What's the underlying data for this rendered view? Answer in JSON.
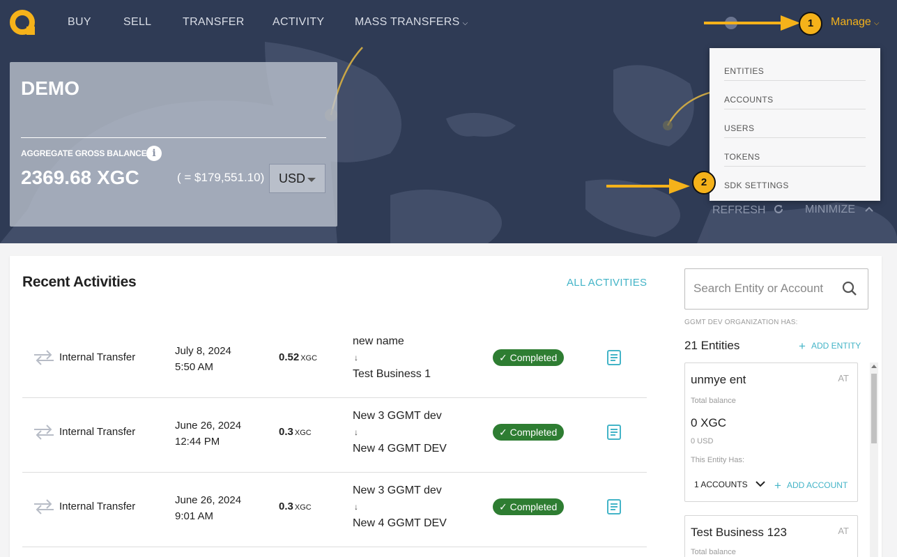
{
  "nav": {
    "items": [
      "BUY",
      "SELL",
      "TRANSFER",
      "ACTIVITY",
      "MASS TRANSFERS"
    ],
    "manage_label": "Manage"
  },
  "balance_card": {
    "title": "DEMO",
    "aggregate_label": "AGGREGATE GROSS BALANCE",
    "info_glyph": "i",
    "amount": "2369.68 XGC",
    "usd_equivalent": "( = $179,551.10)",
    "currency": "USD"
  },
  "hero_actions": {
    "refresh": "REFRESH",
    "minimize": "MINIMIZE"
  },
  "manage_menu": [
    "ENTITIES",
    "ACCOUNTS",
    "USERS",
    "TOKENS",
    "SDK SETTINGS"
  ],
  "annotations": [
    "1",
    "2"
  ],
  "recent": {
    "title": "Recent Activities",
    "all_link": "ALL ACTIVITIES",
    "rows": [
      {
        "type": "Internal Transfer",
        "date": "July 8, 2024",
        "time": "5:50 AM",
        "amount": "0.52",
        "unit": "XGC",
        "from": "new name",
        "arrow": "↓",
        "to": "Test Business 1",
        "status": "Completed"
      },
      {
        "type": "Internal Transfer",
        "date": "June 26, 2024",
        "time": "12:44 PM",
        "amount": "0.3",
        "unit": "XGC",
        "from": "New 3 GGMT dev",
        "arrow": "↓",
        "to": "New 4 GGMT DEV",
        "status": "Completed"
      },
      {
        "type": "Internal Transfer",
        "date": "June 26, 2024",
        "time": "9:01 AM",
        "amount": "0.3",
        "unit": "XGC",
        "from": "New 3 GGMT dev",
        "arrow": "↓",
        "to": "New 4 GGMT DEV",
        "status": "Completed"
      }
    ]
  },
  "sidebar": {
    "search_placeholder": "Search Entity or Account",
    "org_has": "GGMT DEV ORGANIZATION HAS:",
    "entity_count": "21 Entities",
    "add_entity": "ADD ENTITY",
    "entities": [
      {
        "name": "unmye ent",
        "tag": "AT",
        "total_label": "Total balance",
        "balance": "0 XGC",
        "usd": "0 USD",
        "has_label": "This Entity Has:",
        "accounts": "1 ACCOUNTS",
        "add_account": "ADD ACCOUNT"
      },
      {
        "name": "Test Business 123",
        "tag": "AT",
        "total_label": "Total balance"
      }
    ]
  },
  "colors": {
    "hero_bg": "#2f3b55",
    "accent": "#f5b21a",
    "link": "#43b4c7",
    "status_green": "#2e7d32"
  }
}
